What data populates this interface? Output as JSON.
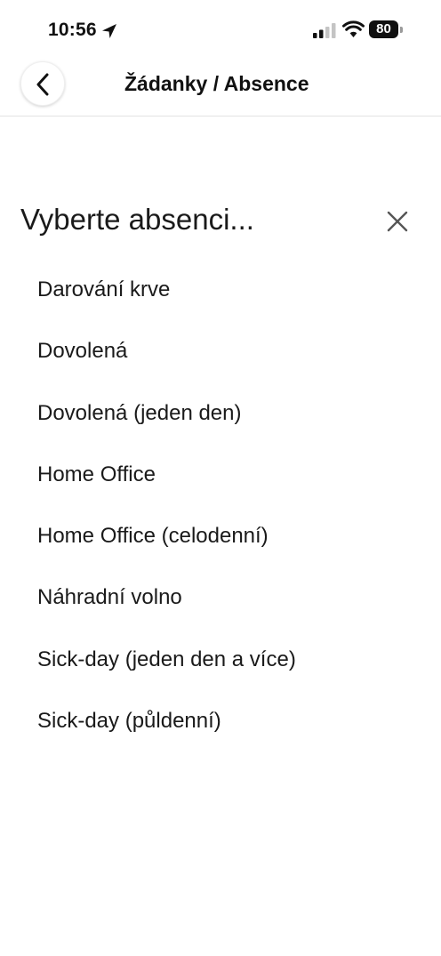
{
  "status_bar": {
    "time": "10:56",
    "battery_level": "80",
    "icons": [
      "location-arrow-icon",
      "cellular-signal-icon",
      "wifi-icon",
      "battery-icon"
    ]
  },
  "header": {
    "title": "Žádanky / Absence",
    "back_icon": "chevron-left-icon"
  },
  "picker": {
    "title": "Vyberte absenci...",
    "close_icon": "close-icon",
    "options": [
      "Darování krve",
      "Dovolená",
      "Dovolená (jeden den)",
      "Home Office",
      "Home Office (celodenní)",
      "Náhradní volno",
      "Sick-day (jeden den a více)",
      "Sick-day (půldenní)"
    ]
  }
}
